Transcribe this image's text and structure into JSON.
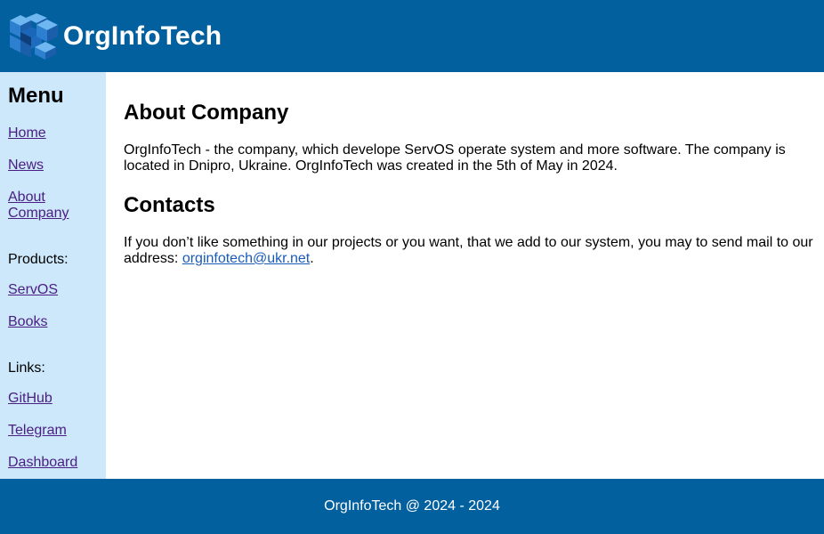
{
  "header": {
    "brand": "OrgInfoTech"
  },
  "sidebar": {
    "title": "Menu",
    "home": "Home",
    "news": "News",
    "about_line1": "About",
    "about_line2": "Company",
    "products_label": "Products:",
    "servos": "ServOS",
    "books": "Books",
    "links_label": "Links:",
    "github": "GitHub",
    "telegram": "Telegram",
    "dashboard": "Dashboard"
  },
  "main": {
    "about_heading": "About Company",
    "about_text": "OrgInfoTech - the company, which develope ServOS operate system and more software. The company is located in Dnipro, Ukraine. OrgInfoTech was created in the 5th of May in 2024.",
    "contacts_heading": "Contacts",
    "contacts_text_before": "If you don’t like something in our projects or you want, that we add to our system, you may to send mail to our address: ",
    "contacts_email": "orginfotech@ukr.net",
    "contacts_text_after": "."
  },
  "footer": {
    "text": "OrgInfoTech @ 2024 - 2024"
  },
  "colors": {
    "header_bg": "#03609f",
    "sidebar_bg": "#cce8fa",
    "visited_link": "#4a1e83",
    "link": "#1a5bb8"
  }
}
